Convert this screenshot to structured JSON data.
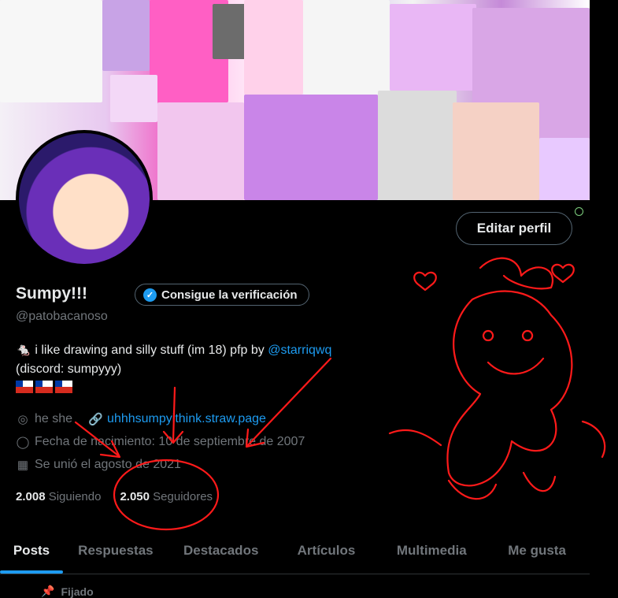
{
  "profile": {
    "display_name": "Sumpy!!!",
    "handle": "@patobacanoso",
    "verify_button": "Consigue la verificación",
    "edit_button": "Editar perfil",
    "bio_prefix": "🐁 i like drawing and silly stuff (im 18) pfp by ",
    "bio_mention": "@starriqwq",
    "bio_line2": "(discord: sumpyyy)",
    "flags_count": 3
  },
  "meta": {
    "pronouns": "he she",
    "website": "uhhhsumpyithink.straw.page",
    "birthday": "Fecha de nacimiento: 10 de septiembre de 2007",
    "joined": "Se unió el agosto de 2021"
  },
  "counts": {
    "following_value": "2.008",
    "following_label": "Siguiendo",
    "followers_value": "2.050",
    "followers_label": "Seguidores"
  },
  "tabs": [
    {
      "label": "Posts"
    },
    {
      "label": "Respuestas"
    },
    {
      "label": "Destacados"
    },
    {
      "label": "Artículos"
    },
    {
      "label": "Multimedia"
    },
    {
      "label": "Me gusta"
    }
  ],
  "pinned_label": "Fijado",
  "colors": {
    "accent": "#1d9bf0",
    "annotation_red": "#ff1a1a",
    "background": "#000000"
  }
}
